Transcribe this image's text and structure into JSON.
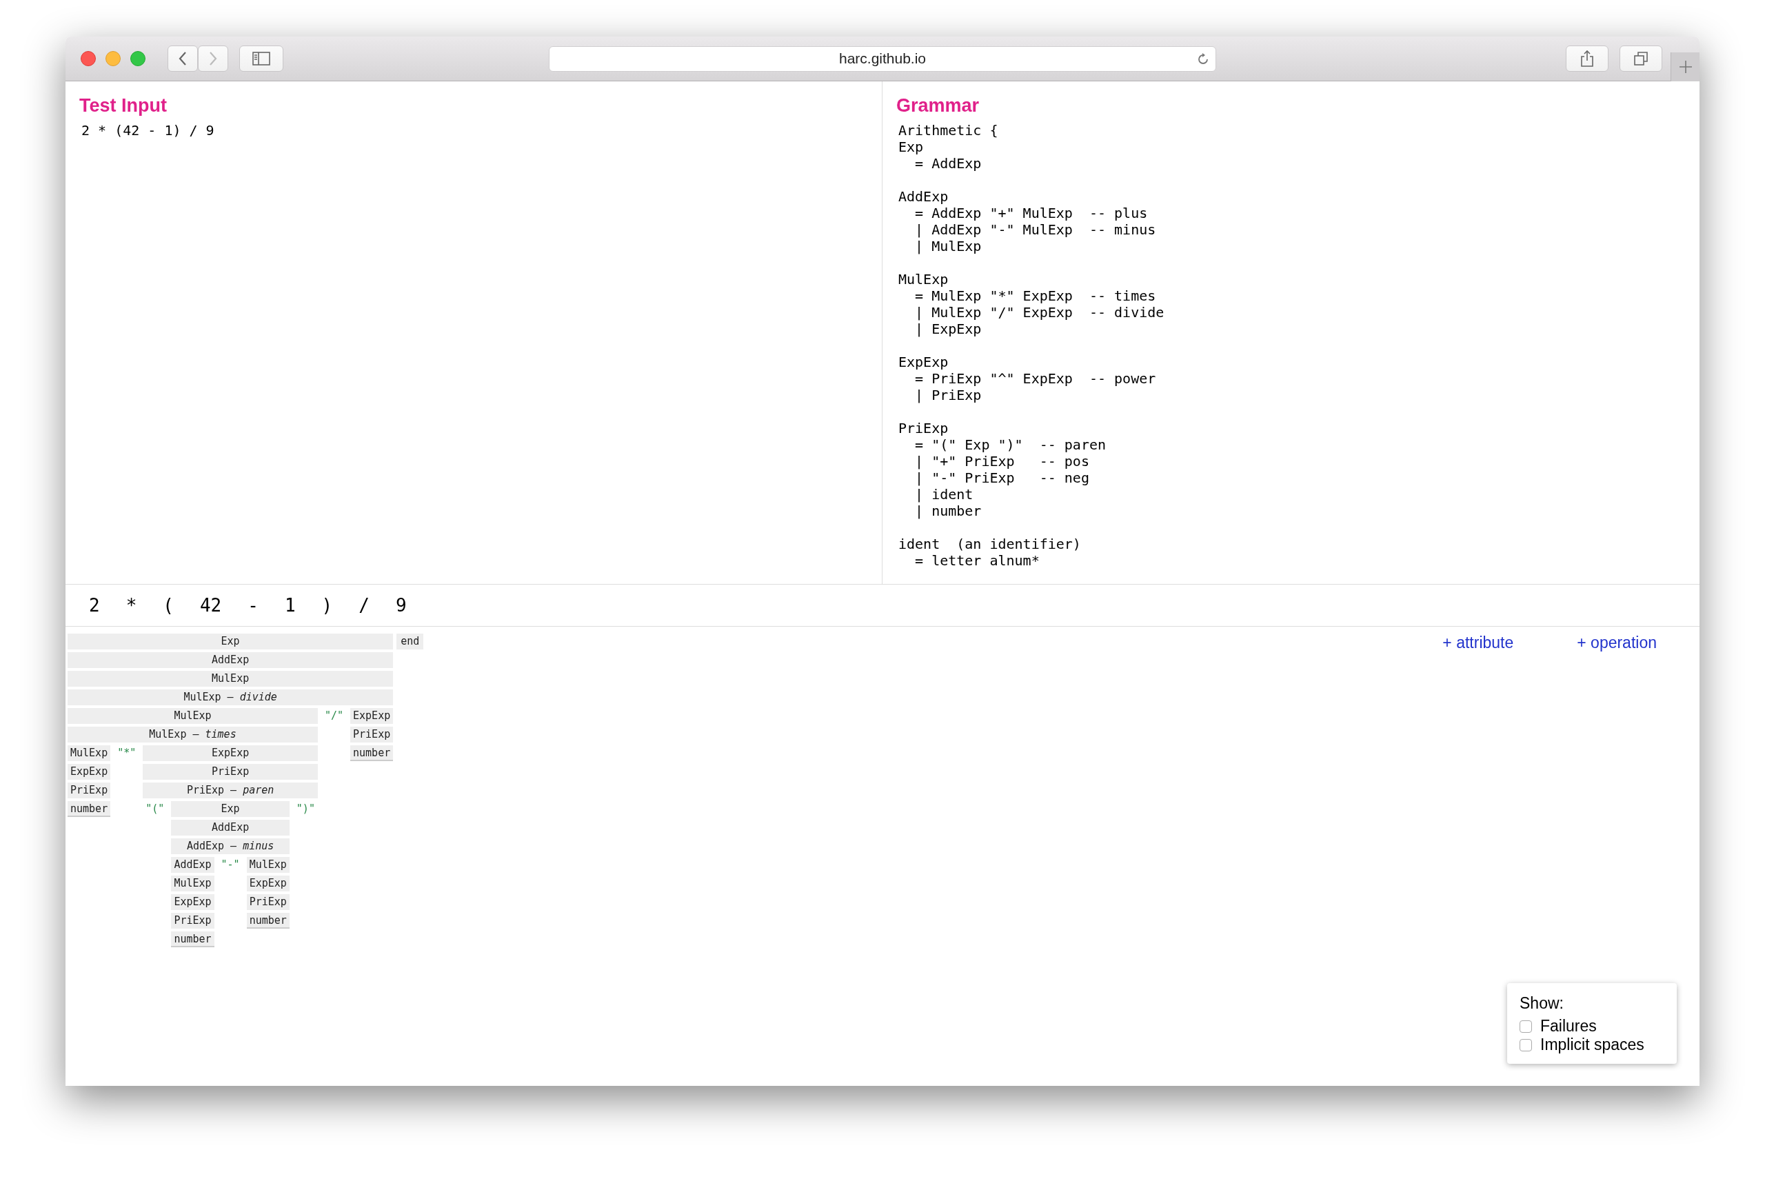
{
  "browser": {
    "url": "harc.github.io"
  },
  "test_input": {
    "title": "Test Input",
    "text": "2 * (42 - 1) / 9"
  },
  "grammar": {
    "title": "Grammar",
    "blocks": [
      [
        "Arithmetic {",
        "Exp",
        "  = AddExp"
      ],
      [
        "AddExp",
        "  = AddExp \"+\" MulExp  -- plus",
        "  | AddExp \"-\" MulExp  -- minus",
        "  | MulExp"
      ],
      [
        "MulExp",
        "  = MulExp \"*\" ExpExp  -- times",
        "  | MulExp \"/\" ExpExp  -- divide",
        "  | ExpExp"
      ],
      [
        "ExpExp",
        "  = PriExp \"^\" ExpExp  -- power",
        "  | PriExp"
      ],
      [
        "PriExp",
        "  = \"(\" Exp \")\"  -- paren",
        "  | \"+\" PriExp   -- pos",
        "  | \"-\" PriExp   -- neg",
        "  | ident",
        "  | number"
      ],
      [
        "ident  (an identifier)",
        "  = letter alnum*"
      ]
    ]
  },
  "tokens": [
    "2",
    "*",
    "(",
    "42",
    "-",
    "1",
    ")",
    "/",
    "9"
  ],
  "parse_tree": {
    "nodes": [
      {
        "kind": "rule",
        "label": "Exp",
        "children": [
          {
            "kind": "rule",
            "label": "AddExp",
            "children": [
              {
                "kind": "rule",
                "label": "MulExp",
                "children": [
                  {
                    "kind": "rule",
                    "label": "MulExp — *divide*",
                    "children": [
                      {
                        "kind": "rule",
                        "label": "MulExp",
                        "children": [
                          {
                            "kind": "rule",
                            "label": "MulExp — *times*",
                            "children": [
                              {
                                "kind": "rule",
                                "label": "MulExp",
                                "children": [
                                  {
                                    "kind": "rule",
                                    "label": "ExpExp",
                                    "children": [
                                      {
                                        "kind": "rule",
                                        "label": "PriExp",
                                        "children": [
                                          {
                                            "kind": "rule",
                                            "label": "number"
                                          }
                                        ]
                                      }
                                    ]
                                  }
                                ]
                              },
                              {
                                "kind": "terminal",
                                "label": "\"*\""
                              },
                              {
                                "kind": "rule",
                                "label": "ExpExp",
                                "children": [
                                  {
                                    "kind": "rule",
                                    "label": "PriExp",
                                    "children": [
                                      {
                                        "kind": "rule",
                                        "label": "PriExp — *paren*",
                                        "children": [
                                          {
                                            "kind": "terminal",
                                            "label": "\"(\""
                                          },
                                          {
                                            "kind": "rule",
                                            "label": "Exp",
                                            "children": [
                                              {
                                                "kind": "rule",
                                                "label": "AddExp",
                                                "children": [
                                                  {
                                                    "kind": "rule",
                                                    "label": "AddExp — *minus*",
                                                    "children": [
                                                      {
                                                        "kind": "rule",
                                                        "label": "AddExp",
                                                        "children": [
                                                          {
                                                            "kind": "rule",
                                                            "label": "MulExp",
                                                            "children": [
                                                              {
                                                                "kind": "rule",
                                                                "label": "ExpExp",
                                                                "children": [
                                                                  {
                                                                    "kind": "rule",
                                                                    "label": "PriExp",
                                                                    "children": [
                                                                      {
                                                                        "kind": "rule",
                                                                        "label": "number"
                                                                      }
                                                                    ]
                                                                  }
                                                                ]
                                                              }
                                                            ]
                                                          }
                                                        ]
                                                      },
                                                      {
                                                        "kind": "terminal",
                                                        "label": "\"-\""
                                                      },
                                                      {
                                                        "kind": "rule",
                                                        "label": "MulExp",
                                                        "children": [
                                                          {
                                                            "kind": "rule",
                                                            "label": "ExpExp",
                                                            "children": [
                                                              {
                                                                "kind": "rule",
                                                                "label": "PriExp",
                                                                "children": [
                                                                  {
                                                                    "kind": "rule",
                                                                    "label": "number"
                                                                  }
                                                                ]
                                                              }
                                                            ]
                                                          }
                                                        ]
                                                      }
                                                    ]
                                                  }
                                                ]
                                              }
                                            ]
                                          },
                                          {
                                            "kind": "terminal",
                                            "label": "\")\""
                                          }
                                        ]
                                      }
                                    ]
                                  }
                                ]
                              }
                            ]
                          }
                        ]
                      },
                      {
                        "kind": "terminal",
                        "label": "\"/\""
                      },
                      {
                        "kind": "rule",
                        "label": "ExpExp",
                        "children": [
                          {
                            "kind": "rule",
                            "label": "PriExp",
                            "children": [
                              {
                                "kind": "rule",
                                "label": "number"
                              }
                            ]
                          }
                        ]
                      }
                    ]
                  }
                ]
              }
            ]
          }
        ]
      },
      {
        "kind": "end",
        "label": "end"
      }
    ]
  },
  "actions": [
    "+ attribute",
    "+ operation"
  ],
  "show": {
    "title": "Show:",
    "options": [
      {
        "label": "Failures",
        "checked": false
      },
      {
        "label": "Implicit spaces",
        "checked": false
      }
    ]
  }
}
